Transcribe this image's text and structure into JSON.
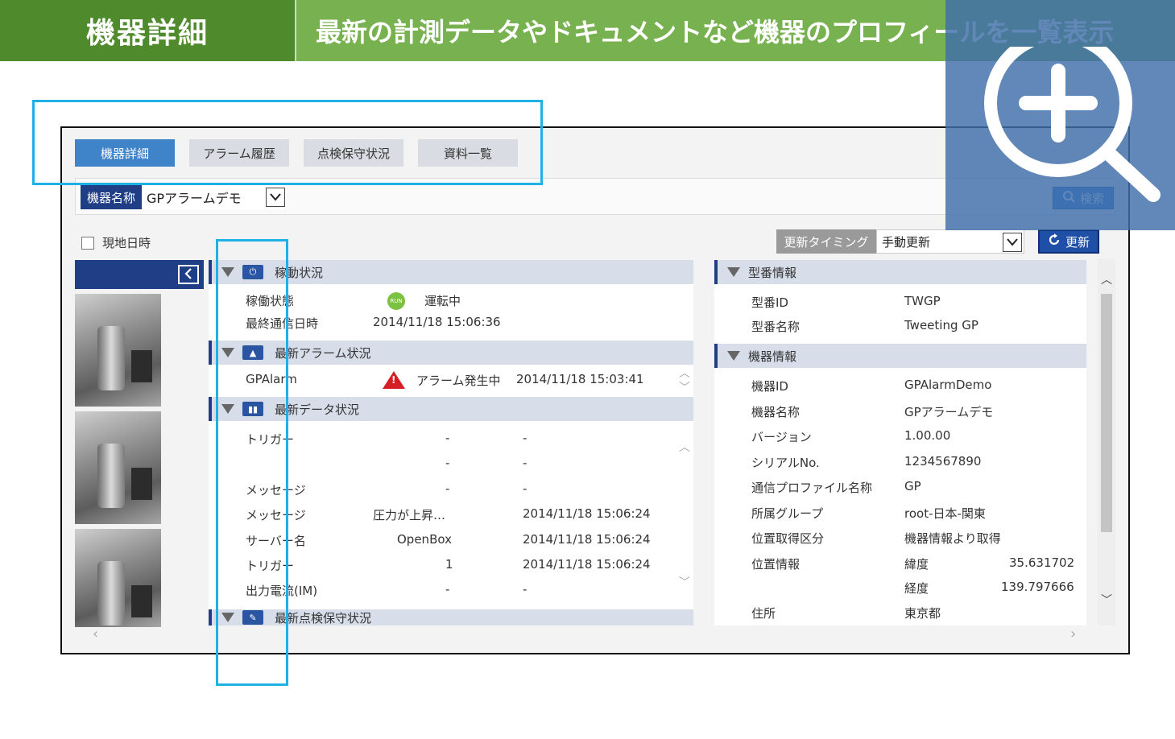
{
  "banner": {
    "title": "機器詳細",
    "description": "最新の計測データやドキュメントなど機器のプロフィールを一覧表示"
  },
  "tabs": [
    {
      "label": "機器詳細",
      "active": true
    },
    {
      "label": "アラーム履歴",
      "active": false
    },
    {
      "label": "点検保守状況",
      "active": false
    },
    {
      "label": "資料一覧",
      "active": false
    }
  ],
  "filter": {
    "device_label": "機器名称",
    "device_value": "GPアラームデモ",
    "search_label": "検索"
  },
  "toolbar": {
    "local_time_label": "現地日時",
    "update_timing_label": "更新タイミング",
    "update_timing_value": "手動更新",
    "refresh_label": "更新"
  },
  "operation": {
    "title": "稼動状況",
    "status_label": "稼働状態",
    "status_badge": "RUN",
    "status_value": "運転中",
    "last_comm_label": "最終通信日時",
    "last_comm_value": "2014/11/18 15:06:36"
  },
  "alarm": {
    "title": "最新アラーム状況",
    "name": "GPAlarm",
    "status": "アラーム発生中",
    "time": "2014/11/18 15:03:41"
  },
  "data_status": {
    "title": "最新データ状況",
    "rows": [
      {
        "name": "トリガー",
        "value": "-",
        "time": "-"
      },
      {
        "name": "",
        "value": "-",
        "time": "-"
      },
      {
        "name": "メッセージ",
        "value": "-",
        "time": "-"
      },
      {
        "name": "メッセージ",
        "value": "圧力が上昇…",
        "time": "2014/11/18 15:06:24"
      },
      {
        "name": "サーバー名",
        "value": "OpenBox",
        "time": "2014/11/18 15:06:24"
      },
      {
        "name": "トリガー",
        "value": "1",
        "time": "2014/11/18 15:06:24"
      },
      {
        "name": "出力電流(IM)",
        "value": "-",
        "time": "-"
      }
    ]
  },
  "maintenance": {
    "title": "最新点検保守状況"
  },
  "model_info": {
    "title": "型番情報",
    "rows": [
      {
        "label": "型番ID",
        "value": "TWGP"
      },
      {
        "label": "型番名称",
        "value": "Tweeting GP"
      }
    ]
  },
  "device_info": {
    "title": "機器情報",
    "rows": [
      {
        "label": "機器ID",
        "value": "GPAlarmDemo"
      },
      {
        "label": "機器名称",
        "value": "GPアラームデモ"
      },
      {
        "label": "バージョン",
        "value": "1.00.00"
      },
      {
        "label": "シリアルNo.",
        "value": "1234567890"
      },
      {
        "label": "通信プロファイル名称",
        "value": "GP"
      },
      {
        "label": "所属グループ",
        "value": "root-日本-関東"
      },
      {
        "label": "位置取得区分",
        "value": "機器情報より取得"
      }
    ],
    "location_label": "位置情報",
    "latitude_label": "緯度",
    "latitude_value": "35.631702",
    "longitude_label": "経度",
    "longitude_value": "139.797666",
    "address_label": "住所",
    "address_value": "東京都"
  },
  "colors": {
    "banner_dark": "#4f8a2c",
    "banner_light": "#78b14f",
    "accent_blue": "#1f3e85",
    "highlight": "#1fb1e6",
    "alarm_red": "#d51f26"
  }
}
